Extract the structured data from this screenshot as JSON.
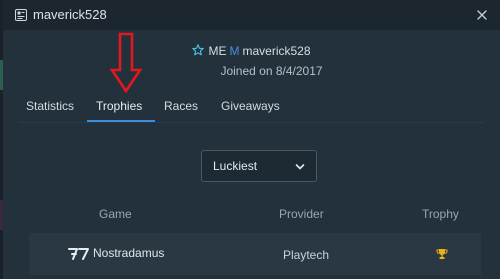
{
  "window": {
    "title": "maverick528"
  },
  "profile": {
    "badge_prefix": "ME",
    "badge_letter": "M",
    "username": "maverick528",
    "joined": "Joined on 8/4/2017"
  },
  "tabs": [
    {
      "label": "Statistics",
      "active": false
    },
    {
      "label": "Trophies",
      "active": true
    },
    {
      "label": "Races",
      "active": false
    },
    {
      "label": "Giveaways",
      "active": false
    }
  ],
  "filter": {
    "selected": "Luckiest"
  },
  "table": {
    "headers": [
      "Game",
      "Provider",
      "Trophy"
    ],
    "rows": [
      {
        "game": "Nostradamus",
        "provider": "Playtech",
        "trophy_icon": "trophy-icon"
      }
    ]
  },
  "colors": {
    "accent": "#3a8ed8",
    "annotation_arrow": "#e0181f",
    "trophy": "#e8b21a",
    "star": "#4ec7e6"
  }
}
